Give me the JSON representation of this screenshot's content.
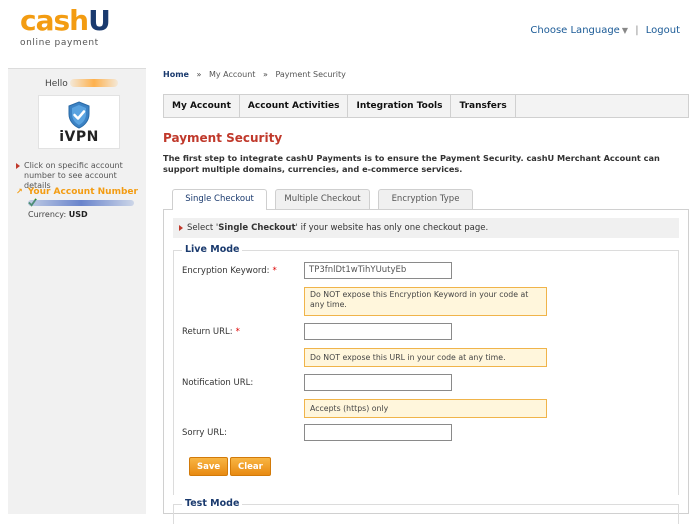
{
  "brand": {
    "logo_main_a": "cash",
    "logo_main_b": "U",
    "logo_sub": "online payment",
    "accent": "#f39c12",
    "brand_blue": "#1a3a6e",
    "title_red": "#c0392b"
  },
  "top_links": {
    "language": "Choose Language",
    "separator": "|",
    "logout": "Logout"
  },
  "sidebar": {
    "hello": "Hello",
    "vpn_label": "iVPN",
    "hint": "Click on specific account number to see account details",
    "account_number_label": "Your Account Number",
    "currency_label": "Currency:",
    "currency_value": "USD"
  },
  "breadcrumb": {
    "home": "Home",
    "sep": "»",
    "items": [
      "My Account",
      "Payment Security"
    ]
  },
  "nav": {
    "items": [
      "My Account",
      "Account Activities",
      "Integration Tools",
      "Transfers"
    ]
  },
  "page": {
    "title": "Payment Security",
    "intro": "The first step to integrate cashU Payments is to ensure the Payment Security. cashU Merchant Account can support multiple domains, currencies, and e-commerce services."
  },
  "tabs": {
    "single": "Single Checkout",
    "multiple": "Multiple Checkout",
    "encryption": "Encryption Type",
    "active": "single"
  },
  "notice": {
    "prefix": "Select '",
    "bold": "Single Checkout",
    "suffix": "' if your website has only one checkout page."
  },
  "live_mode": {
    "legend": "Live Mode",
    "encryption_keyword_label": "Encryption Keyword:",
    "encryption_keyword_value": "TP3fnlDt1wTihYUutyEb",
    "encryption_hint": "Do NOT expose this Encryption Keyword in your code at any time.",
    "return_url_label": "Return URL:",
    "return_url_value": "",
    "return_url_hint": "Do NOT expose this URL in your code at any time.",
    "notification_url_label": "Notification URL:",
    "notification_url_value": "",
    "notification_hint": "Accepts (https) only",
    "sorry_url_label": "Sorry URL:",
    "sorry_url_value": "",
    "required_mark": "*",
    "save": "Save",
    "clear": "Clear"
  },
  "test_mode": {
    "legend": "Test Mode"
  }
}
